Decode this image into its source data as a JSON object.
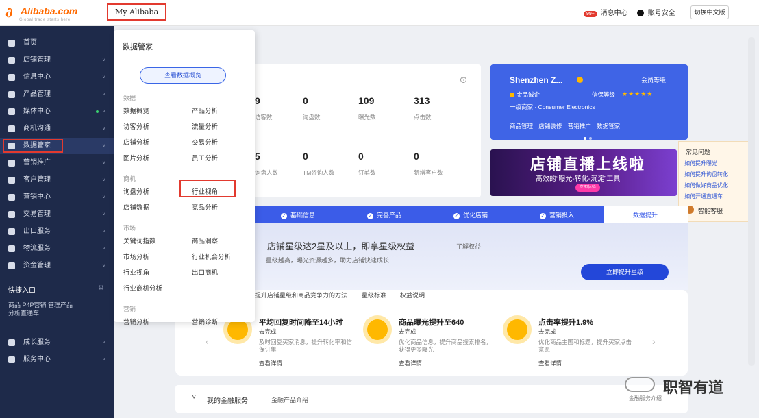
{
  "header": {
    "logo_text": "Alibaba.com",
    "logo_sub": "Global trade starts here",
    "my_alibaba": "My Alibaba",
    "messages_badge": "99+",
    "messages": "消息中心",
    "account": "账号安全",
    "switch_button": "切换中文版"
  },
  "sidebar": {
    "items": [
      {
        "label": "首页"
      },
      {
        "label": "店铺管理"
      },
      {
        "label": "信息中心"
      },
      {
        "label": "产品管理"
      },
      {
        "label": "媒体中心"
      },
      {
        "label": "商机沟通"
      },
      {
        "label": "数据管家"
      },
      {
        "label": "营销推广"
      },
      {
        "label": "客户管理"
      },
      {
        "label": "营销中心"
      },
      {
        "label": "交易管理"
      },
      {
        "label": "出口服务"
      },
      {
        "label": "物流服务"
      },
      {
        "label": "资金管理"
      }
    ],
    "quick_title": "快捷入口",
    "quick_links": "商品  P4P营销  管理产品\n分析直通车",
    "bottom_items": [
      {
        "label": "成长服务"
      },
      {
        "label": "服务中心"
      }
    ]
  },
  "dropdown": {
    "title": "数据管家",
    "primary_button": "查看数据概览",
    "sections": [
      {
        "title": "数据",
        "links": [
          "数据概览",
          "产品分析",
          "访客分析",
          "流量分析",
          "店铺分析",
          "交易分析",
          "图片分析",
          "员工分析"
        ]
      },
      {
        "title": "商机",
        "links": [
          "询盘分析",
          "行业视角",
          "店铺数据",
          "竞品分析"
        ]
      },
      {
        "title": "市场",
        "links": [
          "关键词指数",
          "商品洞察",
          "市场分析",
          "行业机会分析",
          "行业视角",
          "出口商机",
          "行业商机分析"
        ]
      },
      {
        "title": "营销",
        "links": [
          "营销分析",
          "营销诊断"
        ]
      }
    ],
    "highlighted_link": "行业视角"
  },
  "stats": [
    {
      "value": "9",
      "label": "访客数"
    },
    {
      "value": "0",
      "label": "询盘数"
    },
    {
      "value": "109",
      "label": "曝光数"
    },
    {
      "value": "313",
      "label": "点击数"
    },
    {
      "value": "5",
      "label": "询盘人数"
    },
    {
      "value": "0",
      "label": "TM咨询人数"
    },
    {
      "value": "0",
      "label": "订单数"
    },
    {
      "value": "0",
      "label": "新增客户数"
    }
  ],
  "shop": {
    "name": "Shenzhen Z...",
    "level_label": "会员等级",
    "row1_left": "金品诚企",
    "row1_right": "信保等级",
    "stars": "★★★★★",
    "row2": "一级商家 · Consumer Electronics",
    "links": "商品管理 店铺装修 营销推广 数据管家"
  },
  "banner": {
    "title": "店铺直播上线啦",
    "subtitle": "高效的“曝光-转化-沉淀”工具",
    "button": "立即体验"
  },
  "right_panel": {
    "title": "常见问题",
    "links": [
      "如何提升曝光",
      "如何提升询盘转化",
      "如何做好商品优化",
      "如何开通直通车"
    ],
    "robot_label": "智能客服"
  },
  "steps": [
    {
      "label": "基础信息"
    },
    {
      "label": "完善产品"
    },
    {
      "label": "优化店铺"
    },
    {
      "label": "营销投入"
    }
  ],
  "step_active": "数据提升",
  "promo": {
    "headline": "店铺星级达2星及以上，即享星级权益",
    "small": "了解权益",
    "desc": "星级越高，曝光资源越多，助力店铺快速成长",
    "button": "立即提升星级"
  },
  "tabs": [
    "提升店铺星级和商品竞争力的方法",
    "星级标准",
    "权益说明"
  ],
  "features": [
    {
      "title": "平均回复时间降至14小时",
      "sub": "去完成",
      "desc": "及时回复买家消息，提升转化率和信保订单",
      "link": "查看详情"
    },
    {
      "title": "商品曝光提升至640",
      "sub": "去完成",
      "desc": "优化商品信息，提升商品搜索排名，获得更多曝光",
      "link": "查看详情"
    },
    {
      "title": "点击率提升1.9%",
      "sub": "去完成",
      "desc": "优化商品主图和标题，提升买家点击意愿",
      "link": "查看详情"
    }
  ],
  "bottom": {
    "title": "我的金融服务",
    "link": "金融产品介绍"
  },
  "watermark": {
    "text": "职智有道",
    "sub": "金融服务介绍"
  }
}
